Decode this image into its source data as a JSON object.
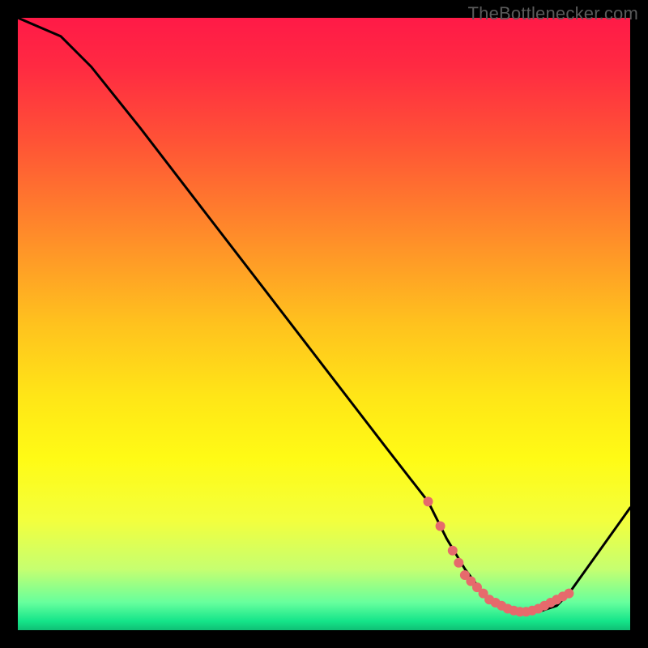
{
  "watermark": "TheBottlenecker.com",
  "gradient": {
    "stops": [
      {
        "offset": 0.0,
        "color": "#ff1a47"
      },
      {
        "offset": 0.08,
        "color": "#ff2a42"
      },
      {
        "offset": 0.2,
        "color": "#ff5236"
      },
      {
        "offset": 0.35,
        "color": "#ff8a2a"
      },
      {
        "offset": 0.5,
        "color": "#ffc21e"
      },
      {
        "offset": 0.62,
        "color": "#ffe617"
      },
      {
        "offset": 0.72,
        "color": "#fffb15"
      },
      {
        "offset": 0.82,
        "color": "#f3ff3d"
      },
      {
        "offset": 0.9,
        "color": "#c6ff70"
      },
      {
        "offset": 0.955,
        "color": "#66ff9d"
      },
      {
        "offset": 0.985,
        "color": "#15e58a"
      },
      {
        "offset": 1.0,
        "color": "#0fbf74"
      }
    ]
  },
  "chart_data": {
    "type": "line",
    "title": "",
    "xlabel": "",
    "ylabel": "",
    "xlim": [
      0,
      100
    ],
    "ylim": [
      0,
      100
    ],
    "series": [
      {
        "name": "curve",
        "x": [
          0,
          7,
          12,
          20,
          30,
          40,
          50,
          60,
          67,
          70,
          73,
          76,
          79,
          82,
          85,
          88,
          90,
          100
        ],
        "y": [
          100,
          97,
          92,
          82,
          69,
          56,
          43,
          30,
          21,
          15,
          10,
          6,
          4,
          3,
          3,
          4,
          6,
          20
        ]
      }
    ],
    "markers": {
      "name": "highlight-dots",
      "color": "#e66a6c",
      "x": [
        67,
        69,
        71,
        72,
        73,
        74,
        75,
        76,
        77,
        78,
        79,
        80,
        81,
        82,
        83,
        84,
        85,
        86,
        87,
        88,
        89,
        90
      ],
      "y": [
        21,
        17,
        13,
        11,
        9,
        8,
        7,
        6,
        5,
        4.5,
        4,
        3.5,
        3.2,
        3,
        3,
        3.2,
        3.5,
        4,
        4.5,
        5,
        5.5,
        6
      ]
    }
  }
}
